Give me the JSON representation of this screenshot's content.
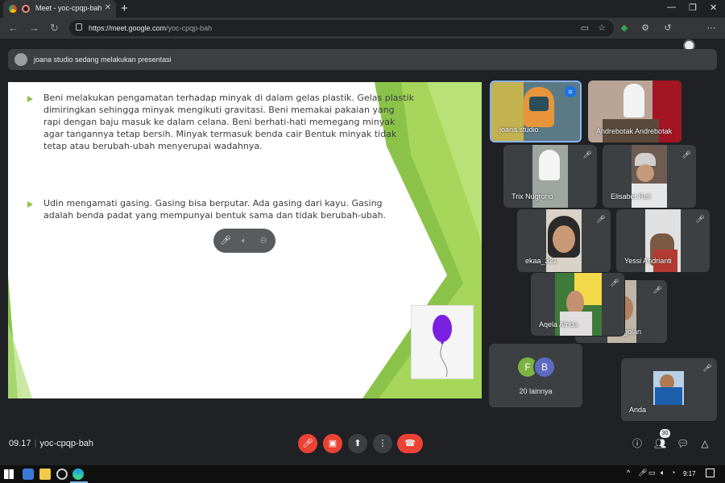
{
  "browser": {
    "tab_title": "Meet - yoc-cpqp-bah",
    "new_tab": "+",
    "url_host": "https://meet.google.com",
    "url_path": "/yoc-cpqp-bah"
  },
  "banner": {
    "text": "joana studio sedang melakukan presentasi"
  },
  "slide": {
    "paragraphs": [
      "Beni melakukan pengamatan terhadap minyak di dalam gelas plastik. Gelas plastik dimiringkan sehingga minyak mengikuti gravitasi. Beni memakai pakaian yang rapi dengan baju masuk ke dalam celana. Beni berhati-hati memegang minyak agar tangannya tetap bersih.  Minyak termasuk benda cair Bentuk minyak tidak tetap atau berubah-ubah menyerupai wadahnya.",
      "Udin mengamati gasing. Gasing bisa berputar. Ada gasing dari kayu. Gasing adalah benda padat  yang mempunyai bentuk sama dan tidak berubah-ubah."
    ]
  },
  "participants": [
    {
      "name": "joana studio"
    },
    {
      "name": "Andrebotak Andrebotak"
    },
    {
      "name": "Trix Nugroho"
    },
    {
      "name": "Elisabet Reli"
    },
    {
      "name": "ekaa_321"
    },
    {
      "name": "Yessi Andrianti"
    },
    {
      "name": "Aqela Afrida"
    },
    {
      "name": "golan"
    },
    {
      "name": "Anda"
    }
  ],
  "others": {
    "avatars": [
      "F",
      "B"
    ],
    "label": "20 lainnya",
    "avatar_colors": [
      "#7cb342",
      "#5c6bc0"
    ]
  },
  "bottom": {
    "time": "09.17",
    "meeting_code": "yoc-cpqp-bah",
    "participant_count": "30"
  },
  "taskbar": {
    "time": "9:17"
  },
  "colors": {
    "accent_blue": "#8ab4f8",
    "danger": "#ea4335"
  }
}
